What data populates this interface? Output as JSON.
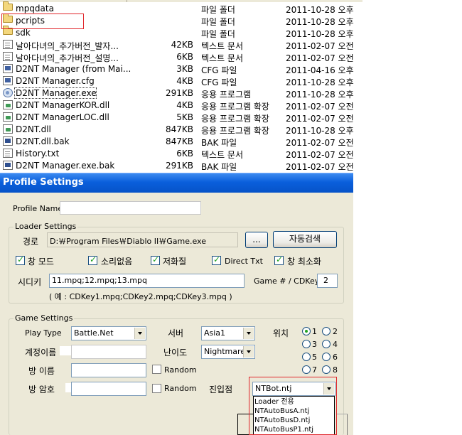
{
  "file_list": {
    "rows": [
      {
        "name": "mpqdata",
        "size": "",
        "type": "파일 폴더",
        "date": "2011-10-28 오후",
        "icon": "folder-icon"
      },
      {
        "name": "pcripts",
        "size": "",
        "type": "파일 폴더",
        "date": "2011-10-28 오후",
        "icon": "folder-icon"
      },
      {
        "name": "sdk",
        "size": "",
        "type": "파일 폴더",
        "date": "2011-10-28 오후",
        "icon": "folder-icon"
      },
      {
        "name": "날아다녀의_추가버전_발자...",
        "size": "42KB",
        "type": "텍스트 문서",
        "date": "2011-02-07 오전",
        "icon": "text-file-icon"
      },
      {
        "name": "날아다녀의_추가버전_설명...",
        "size": "6KB",
        "type": "텍스트 문서",
        "date": "2011-02-07 오전",
        "icon": "text-file-icon"
      },
      {
        "name": "D2NT Manager (from Mai...",
        "size": "3KB",
        "type": "CFG 파일",
        "date": "2011-04-16 오후",
        "icon": "cfg-file-icon"
      },
      {
        "name": "D2NT Manager.cfg",
        "size": "4KB",
        "type": "CFG 파일",
        "date": "2011-10-28 오후",
        "icon": "cfg-file-icon"
      },
      {
        "name": "D2NT Manager.exe",
        "size": "291KB",
        "type": "응용 프로그램",
        "date": "2011-10-28 오후",
        "icon": "exe-file-icon"
      },
      {
        "name": "D2NT ManagerKOR.dll",
        "size": "4KB",
        "type": "응용 프로그램 확장",
        "date": "2011-02-07 오전",
        "icon": "dll-file-icon"
      },
      {
        "name": "D2NT ManagerLOC.dll",
        "size": "5KB",
        "type": "응용 프로그램 확장",
        "date": "2011-02-07 오전",
        "icon": "dll-file-icon"
      },
      {
        "name": "D2NT.dll",
        "size": "847KB",
        "type": "응용 프로그램 확장",
        "date": "2011-10-28 오후",
        "icon": "dll-file-icon"
      },
      {
        "name": "D2NT.dll.bak",
        "size": "847KB",
        "type": "BAK 파일",
        "date": "2011-02-07 오전",
        "icon": "bak-file-icon"
      },
      {
        "name": "History.txt",
        "size": "6KB",
        "type": "텍스트 문서",
        "date": "2011-02-07 오전",
        "icon": "text-file-icon"
      },
      {
        "name": "D2NT Manager.exe.bak",
        "size": "291KB",
        "type": "BAK 파일",
        "date": "2011-02-07 오전",
        "icon": "bak-file-icon"
      }
    ]
  },
  "dialog": {
    "title": "Profile Settings",
    "profile_name_label": "Profile Name",
    "profile_name_value": "",
    "loader": {
      "legend": "Loader Settings",
      "path_label": "경로",
      "path_value": "D:￦Program Files￦Diablo II￦Game.exe",
      "browse_label": "...",
      "autosearch_label": "자동검색",
      "checkboxes": [
        {
          "label": "창 모드",
          "checked": true
        },
        {
          "label": "소리없음",
          "checked": true
        },
        {
          "label": "저화질",
          "checked": true
        },
        {
          "label": "Direct Txt",
          "checked": true
        },
        {
          "label": "창 최소화",
          "checked": true
        }
      ],
      "cdkey_label": "시디키",
      "cdkey_value": "11.mpq;12.mpq;13.mpq",
      "game_cdkey_label": "Game # / CDKey",
      "game_cdkey_value": "2",
      "example_text": "( 예 : CDKey1.mpq;CDKey2.mpq;CDKey3.mpq )"
    },
    "game": {
      "legend": "Game Settings",
      "play_type_label": "Play Type",
      "play_type_value": "Battle.Net",
      "server_label": "서버",
      "server_value": "Asia1",
      "position_label": "위치",
      "account_label": "계정이름",
      "difficulty_label": "난이도",
      "difficulty_value": "Nightmare",
      "room_name_label": "방 이름",
      "room_password_label": "방 암호",
      "random_label": "Random",
      "entry_label": "진입점",
      "entry_value": "NTBot.ntj",
      "positions": [
        {
          "label": "1",
          "selected": true
        },
        {
          "label": "2",
          "selected": false
        },
        {
          "label": "3",
          "selected": false
        },
        {
          "label": "4",
          "selected": false
        },
        {
          "label": "5",
          "selected": false
        },
        {
          "label": "6",
          "selected": false
        },
        {
          "label": "7",
          "selected": false
        },
        {
          "label": "8",
          "selected": false
        }
      ],
      "entry_options": [
        "Loader 전용",
        "NTAutoBusA.ntj",
        "NTAutoBusD.ntj",
        "NTAutoBusP1.ntj"
      ]
    }
  },
  "colors": {
    "titlebar": "#0a5fdc",
    "highlight_box": "#e0262b",
    "dialog_bg": "#ece9d8"
  }
}
